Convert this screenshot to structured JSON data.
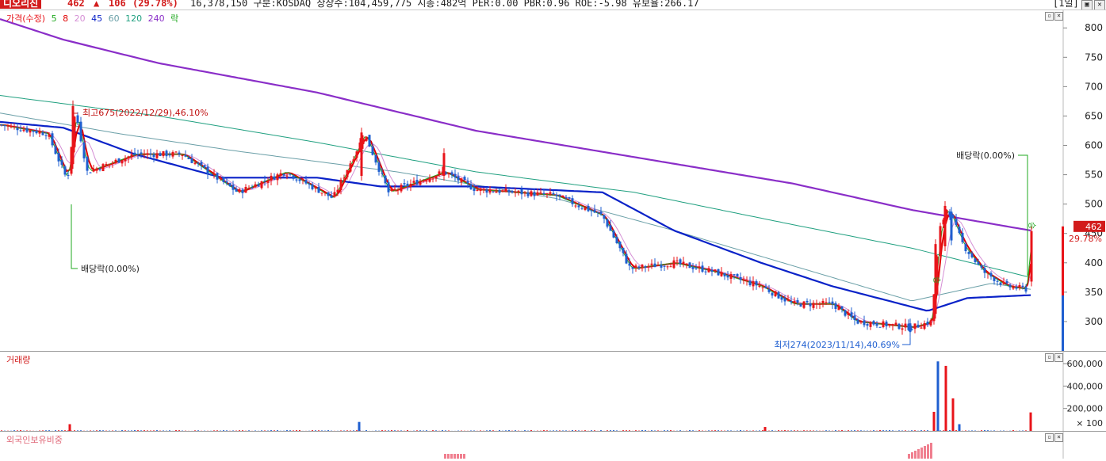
{
  "header": {
    "name": "디오리진",
    "price": "462",
    "arrow": "▲",
    "change": "106",
    "percent": "(29.78%)",
    "info": "16,378,150  구분:KOSDAQ 상장수:104,459,775 시총:482억 PER:0.00 PBR:0.96 ROE:-5.98 유보율:266.17",
    "period": "[1일]"
  },
  "price_panel": {
    "legend": {
      "price": "가격(수정)",
      "ma5": "5",
      "ma8": "8",
      "ma20": "20",
      "ma45": "45",
      "ma60": "60",
      "ma120": "120",
      "ma240": "240",
      "rak": "락"
    },
    "y_ticks": [
      "800",
      "750",
      "700",
      "650",
      "600",
      "550",
      "500",
      "450",
      "400",
      "350",
      "300"
    ],
    "current_price_label": "462",
    "current_pct_label": "29.78%",
    "annotations": {
      "high": "최고675(2022/12/29),46.10%",
      "low": "최저274(2023/11/14),40.69%",
      "dividend1": "배당락(0.00%)",
      "dividend2": "배당락(0.00%)",
      "rak_mark": "락",
      "rights_mark1": "승",
      "rights_mark2": "승"
    }
  },
  "volume_panel": {
    "title": "거래량",
    "y_ticks": [
      "600,000",
      "400,000",
      "200,000"
    ],
    "unit": "× 100"
  },
  "foreign_panel": {
    "title": "외국인보유비중"
  },
  "colors": {
    "up": "#e8141a",
    "down": "#1f5fd0",
    "ma5": "#1fa81f",
    "ma8": "#e00000",
    "ma20": "#d58fd5",
    "ma45": "#0a22c8",
    "ma60": "#6a9fa7",
    "ma120": "#20a080",
    "ma240": "#8a2ec8"
  },
  "chart_data": {
    "type": "candlestick",
    "ylim": [
      250,
      830
    ],
    "keypoints": [
      {
        "t": 0,
        "v": 635
      },
      {
        "t": 60,
        "v": 620
      },
      {
        "t": 85,
        "v": 540
      },
      {
        "t": 95,
        "v": 660
      },
      {
        "t": 110,
        "v": 555
      },
      {
        "t": 170,
        "v": 585
      },
      {
        "t": 230,
        "v": 585
      },
      {
        "t": 300,
        "v": 520
      },
      {
        "t": 360,
        "v": 555
      },
      {
        "t": 420,
        "v": 510
      },
      {
        "t": 460,
        "v": 620
      },
      {
        "t": 490,
        "v": 520
      },
      {
        "t": 560,
        "v": 555
      },
      {
        "t": 600,
        "v": 525
      },
      {
        "t": 700,
        "v": 515
      },
      {
        "t": 760,
        "v": 480
      },
      {
        "t": 795,
        "v": 390
      },
      {
        "t": 850,
        "v": 400
      },
      {
        "t": 900,
        "v": 385
      },
      {
        "t": 960,
        "v": 360
      },
      {
        "t": 1000,
        "v": 330
      },
      {
        "t": 1050,
        "v": 330
      },
      {
        "t": 1080,
        "v": 300
      },
      {
        "t": 1150,
        "v": 290
      },
      {
        "t": 1175,
        "v": 300
      },
      {
        "t": 1185,
        "v": 455
      },
      {
        "t": 1195,
        "v": 495
      },
      {
        "t": 1215,
        "v": 430
      },
      {
        "t": 1240,
        "v": 385
      },
      {
        "t": 1270,
        "v": 360
      },
      {
        "t": 1295,
        "v": 355
      },
      {
        "t": 1300,
        "v": 462
      }
    ],
    "ma240": [
      [
        0,
        815
      ],
      [
        80,
        780
      ],
      [
        200,
        740
      ],
      [
        400,
        690
      ],
      [
        600,
        625
      ],
      [
        800,
        580
      ],
      [
        1000,
        535
      ],
      [
        1150,
        490
      ],
      [
        1300,
        455
      ]
    ],
    "ma120": [
      [
        0,
        685
      ],
      [
        200,
        650
      ],
      [
        400,
        605
      ],
      [
        600,
        555
      ],
      [
        800,
        520
      ],
      [
        1000,
        465
      ],
      [
        1150,
        425
      ],
      [
        1300,
        375
      ]
    ],
    "ma60": [
      [
        0,
        655
      ],
      [
        150,
        620
      ],
      [
        300,
        590
      ],
      [
        500,
        555
      ],
      [
        700,
        510
      ],
      [
        850,
        455
      ],
      [
        1000,
        395
      ],
      [
        1150,
        335
      ],
      [
        1250,
        365
      ],
      [
        1300,
        355
      ]
    ],
    "ma45": [
      [
        0,
        640
      ],
      [
        80,
        630
      ],
      [
        170,
        585
      ],
      [
        280,
        545
      ],
      [
        400,
        545
      ],
      [
        480,
        530
      ],
      [
        600,
        530
      ],
      [
        760,
        520
      ],
      [
        850,
        455
      ],
      [
        960,
        400
      ],
      [
        1050,
        360
      ],
      [
        1170,
        318
      ],
      [
        1220,
        340
      ],
      [
        1300,
        345
      ]
    ],
    "high": {
      "price": 675,
      "date": "2022/12/29",
      "pct": 46.1
    },
    "low": {
      "price": 274,
      "date": "2023/11/14",
      "pct": 40.69
    },
    "last_price": 462,
    "volume_ylim": [
      0,
      650000
    ],
    "volume_spikes": [
      {
        "t": 88,
        "v": 60000
      },
      {
        "t": 453,
        "v": 80000
      },
      {
        "t": 965,
        "v": 35000
      },
      {
        "t": 1178,
        "v": 170000
      },
      {
        "t": 1183,
        "v": 620000
      },
      {
        "t": 1193,
        "v": 580000
      },
      {
        "t": 1202,
        "v": 290000
      },
      {
        "t": 1210,
        "v": 60000
      },
      {
        "t": 1300,
        "v": 165000
      }
    ]
  }
}
